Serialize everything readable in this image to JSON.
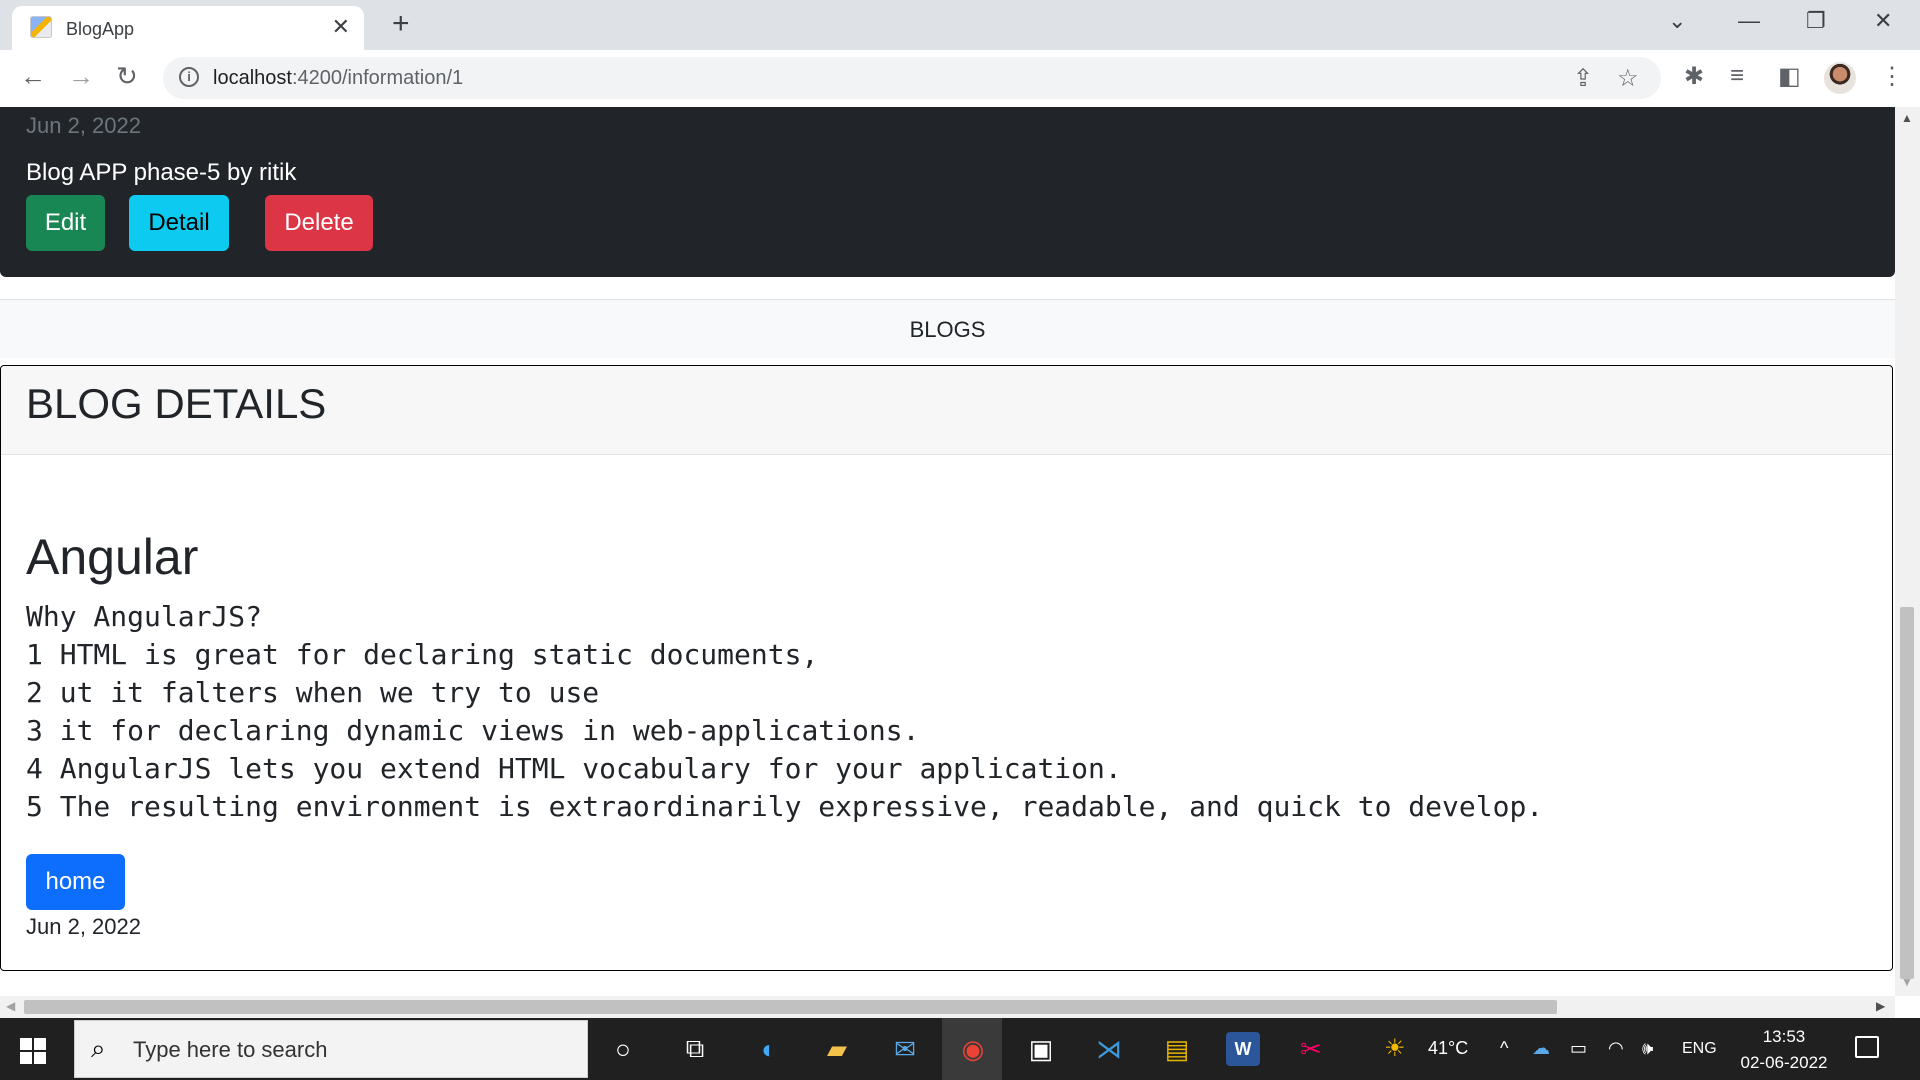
{
  "browser": {
    "tab_title": "BlogApp",
    "url_host": "localhost",
    "url_path": ":4200/information/1"
  },
  "page": {
    "top_card": {
      "date": "Jun 2, 2022",
      "text": "Blog APP phase-5 by ritik",
      "edit_label": "Edit",
      "detail_label": "Detail",
      "delete_label": "Delete"
    },
    "nav_link": "BLOGS",
    "detail": {
      "header": "BLOG DETAILS",
      "title": "Angular",
      "lines": [
        "Why AngularJS?",
        "1 HTML is great for declaring static documents,",
        "2 ut it falters when we try to use",
        "3 it for declaring dynamic views in web-applications.",
        "4 AngularJS lets you extend HTML vocabulary for your application.",
        "5 The resulting environment is extraordinarily expressive, readable, and quick to develop."
      ],
      "home_label": "home",
      "date": "Jun 2, 2022"
    }
  },
  "taskbar": {
    "search_placeholder": "Type here to search",
    "weather": "41°C",
    "language": "ENG",
    "time": "13:53",
    "date": "02-06-2022"
  },
  "colors": {
    "dark_card": "#212529",
    "edit": "#198754",
    "detail": "#0dcaf0",
    "delete": "#dc3545",
    "home": "#0d6efd"
  }
}
